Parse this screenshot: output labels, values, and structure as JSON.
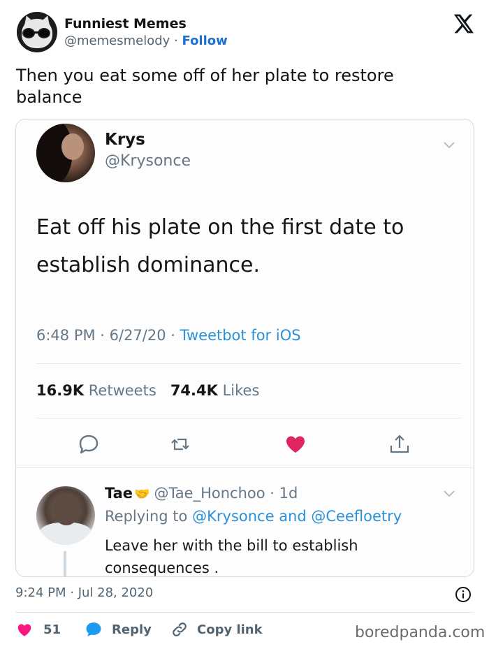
{
  "tweet": {
    "author_name": "Funniest Memes",
    "author_handle": "@memesmelody",
    "separator": "·",
    "follow_label": "Follow",
    "text": "Then you eat some off of her plate to restore balance",
    "timestamp": "9:24 PM · Jul 28, 2020",
    "like_count": "51",
    "reply_label": "Reply",
    "copy_link_label": "Copy link"
  },
  "embedded": {
    "author_name": "Krys",
    "author_handle": "@Krysonce",
    "text": "Eat off his plate on the first date to establish dominance.",
    "meta_time": "6:48 PM · 6/27/20 · ",
    "meta_source": "Tweetbot for iOS",
    "retweets_count": "16.9K",
    "retweets_label": "Retweets",
    "likes_count": "74.4K",
    "likes_label": "Likes",
    "reply": {
      "author_name": "Tae",
      "author_handle": "@Tae_Honchoo",
      "age": "· 1d",
      "replying_prefix": "Replying to",
      "mention_1": "@Krysonce",
      "and_word": "and",
      "mention_2": "@Ceefloetry",
      "text": "Leave her with the bill to establish consequences ."
    }
  },
  "watermark": "boredpanda.com",
  "colors": {
    "follow_blue": "#1d6fd0",
    "heart_red": "#f91880",
    "reply_blue": "#1d9bf0",
    "inner_like_red": "#e0245e",
    "link_blue": "#2a91d6"
  },
  "icons": [
    "x-logo-icon",
    "chevron-down-icon",
    "reply-bubble-icon",
    "retweet-icon",
    "heart-icon",
    "share-icon",
    "info-icon",
    "chat-bubble-icon",
    "link-icon"
  ]
}
